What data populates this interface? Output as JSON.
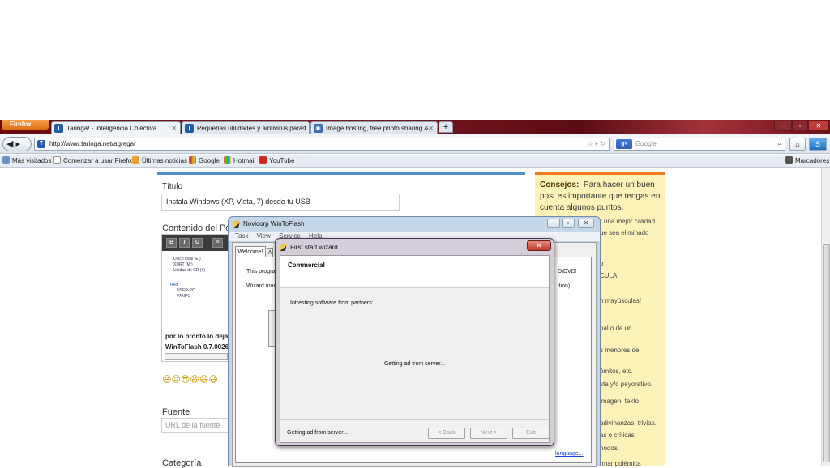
{
  "browser": {
    "menu_button": "Firefox",
    "tabs": [
      {
        "label": "Taringa! - Inteligencia Colectiva",
        "icon": "taringa-favicon"
      },
      {
        "label": "Pequeñas utilidades y aintivirus para t...",
        "icon": "taringa-favicon"
      },
      {
        "label": "Image hosting, free photo sharing & ...",
        "icon": "imageshack-favicon"
      }
    ],
    "new_tab": "+",
    "url": "http://www.taringa.net/agregar",
    "search_placeholder": "Google",
    "search_engine_icon": "google-icon",
    "bookmarks": [
      {
        "label": "Más visitados",
        "icon": "star-folder-icon"
      },
      {
        "label": "Comenzar a usar Firefox",
        "icon": "page-icon"
      },
      {
        "label": "Últimas noticias",
        "icon": "rss-icon"
      },
      {
        "label": "Google",
        "icon": "google-icon"
      },
      {
        "label": "Hotmail",
        "icon": "msn-icon"
      },
      {
        "label": "YouTube",
        "icon": "youtube-icon"
      }
    ],
    "bookmarks_menu": "Marcadores"
  },
  "page": {
    "title_label": "Título",
    "title_value": "Instala Windows (XP, Vista, 7) desde tu USB",
    "content_label": "Contenido del Pos",
    "editor_tools": [
      "B",
      "I",
      "U",
      "≡"
    ],
    "editor_tree": [
      "Disco local (E:)",
      "XDRT (M:)",
      "Unidad de CD (I:)",
      "Red",
      "USER-PC",
      "VANPC"
    ],
    "editor_text_1": "por lo pronto lo dejar",
    "editor_text_2": "WinToFlash 0.7.0026",
    "smileys": "😃😐😎😃😃😃",
    "fuente_label": "Fuente",
    "fuente_placeholder": "URL de la fuente",
    "categoria_label": "Categoría"
  },
  "tips": {
    "heading": "Consejos:",
    "intro": "Para hacer un buen post es importante que tengas en cuenta algunos puntos.",
    "fragments": [
      "r una mejor calidad",
      "ue sea eliminado",
      "o",
      "CULA",
      "",
      "n mayúsculas!",
      "nal o de un",
      "s menores de",
      "ómitos, etc.",
      "sta y/o peyorativo.",
      "imagen, texto",
      "adivinanzas, trivias.",
      "as o críticas.",
      "nodos.",
      "rmar polémica"
    ]
  },
  "wintoflash": {
    "title": "Novicorp WinToFlash",
    "menu": [
      "Task",
      "View",
      "Service",
      "Help"
    ],
    "tab_welcome": "Welcome!",
    "tab_next_initial": "A",
    "line1": "This progra",
    "line1_end": "D/DVD!",
    "line2": "Wizard mod",
    "line2_end": "ition).",
    "language_link": "language..."
  },
  "wizard": {
    "title": "First start wizard",
    "header": "Commercial",
    "content_label": "Intresting software from partners:",
    "center_status": "Getting ad from server...",
    "footer_status": "Getting ad from server...",
    "back_label": "< Back",
    "next_label": "Next >",
    "exit_label": "Exit"
  }
}
